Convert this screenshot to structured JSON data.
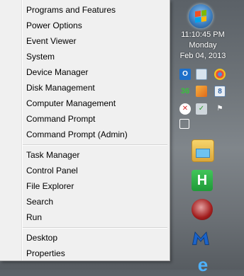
{
  "menu": {
    "group1": [
      "Programs and Features",
      "Power Options",
      "Event Viewer",
      "System",
      "Device Manager",
      "Disk Management",
      "Computer Management",
      "Command Prompt",
      "Command Prompt (Admin)"
    ],
    "group2": [
      "Task Manager",
      "Control Panel",
      "File Explorer",
      "Search",
      "Run"
    ],
    "group3": [
      "Desktop",
      "Properties"
    ]
  },
  "clock": {
    "time": "11:10:45 PM",
    "day": "Monday",
    "date": "Feb 04, 2013"
  },
  "icons": {
    "start": "windows-start-orb",
    "tray": [
      "outlook-icon",
      "remote-desktop-icon",
      "chrome-icon",
      "network-speed-icon",
      "paint-icon",
      "bluetooth-icon",
      "shield-icon",
      "security-check-icon",
      "flag-icon",
      "network-icon"
    ],
    "taskbar": [
      "file-explorer-icon",
      "h-app-icon",
      "media-icon",
      "malwarebytes-icon",
      "internet-explorer-icon"
    ]
  }
}
